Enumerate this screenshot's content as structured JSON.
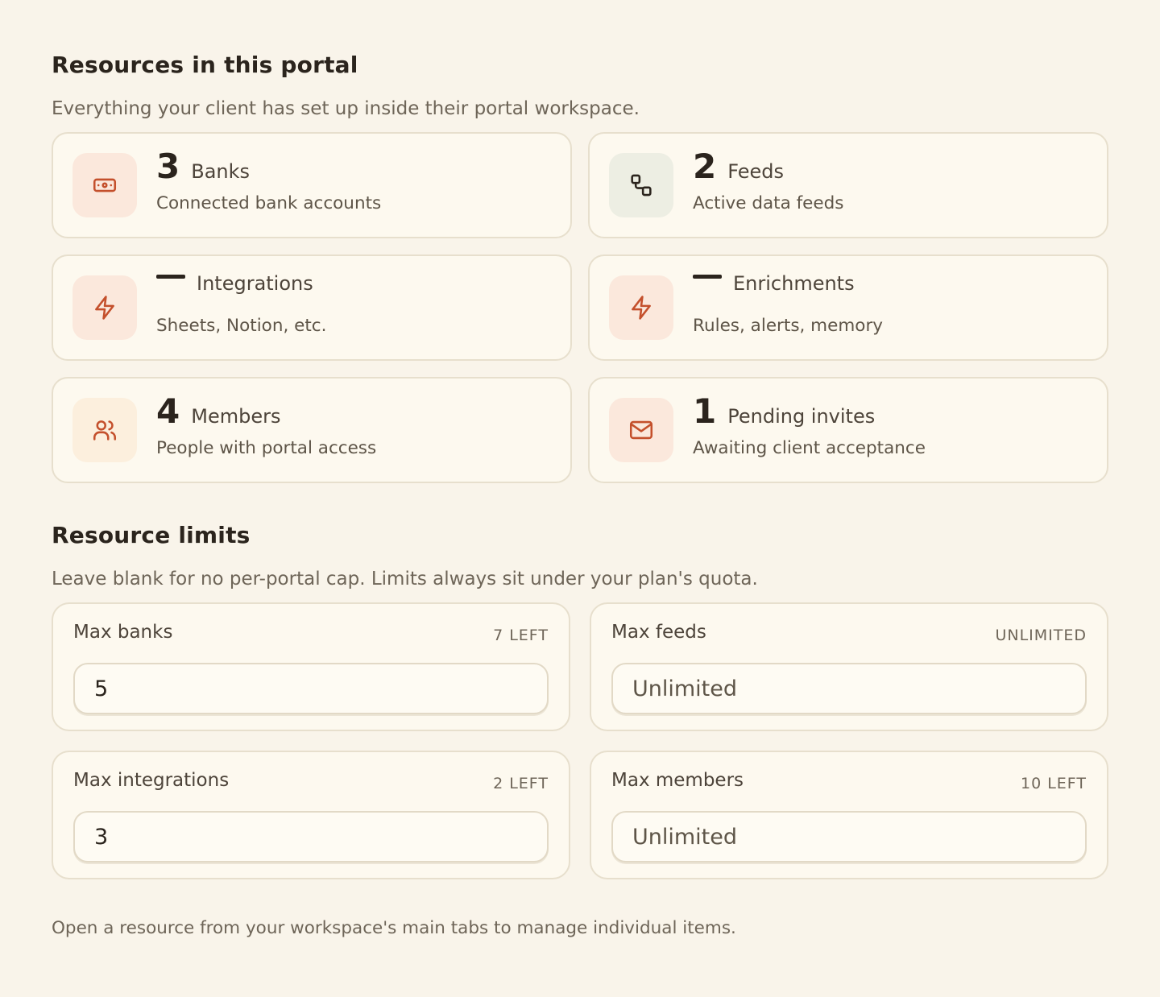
{
  "resources": {
    "title": "Resources in this portal",
    "subtitle": "Everything your client has set up inside their portal workspace.",
    "cards": [
      {
        "count": "3",
        "label": "Banks",
        "desc": "Connected bank accounts",
        "icon": "banknote-icon",
        "tone": "#fbe8dc",
        "icon_color": "#c4502c"
      },
      {
        "count": "2",
        "label": "Feeds",
        "desc": "Active data feeds",
        "icon": "workflow-icon",
        "tone": "#edeee3",
        "icon_color": "#2b241d"
      },
      {
        "count": null,
        "label": "Integrations",
        "desc": "Sheets, Notion, etc.",
        "icon": "zap-icon",
        "tone": "#fbe8dc",
        "icon_color": "#c4502c"
      },
      {
        "count": null,
        "label": "Enrichments",
        "desc": "Rules, alerts, memory",
        "icon": "zap-icon",
        "tone": "#fbe8dc",
        "icon_color": "#c4502c"
      },
      {
        "count": "4",
        "label": "Members",
        "desc": "People with portal access",
        "icon": "users-icon",
        "tone": "#fcefdd",
        "icon_color": "#c4502c"
      },
      {
        "count": "1",
        "label": "Pending invites",
        "desc": "Awaiting client acceptance",
        "icon": "mail-icon",
        "tone": "#fbe8dc",
        "icon_color": "#c4502c"
      }
    ]
  },
  "limits": {
    "title": "Resource limits",
    "subtitle": "Leave blank for no per-portal cap. Limits always sit under your plan's quota.",
    "fields": [
      {
        "label": "Max banks",
        "badge": "7 LEFT",
        "value": "5",
        "placeholder": "Unlimited"
      },
      {
        "label": "Max feeds",
        "badge": "UNLIMITED",
        "value": "",
        "placeholder": "Unlimited"
      },
      {
        "label": "Max integrations",
        "badge": "2 LEFT",
        "value": "3",
        "placeholder": "Unlimited"
      },
      {
        "label": "Max members",
        "badge": "10 LEFT",
        "value": "",
        "placeholder": "Unlimited"
      }
    ]
  },
  "footer_note": "Open a resource from your workspace's main tabs to manage individual items.",
  "colors": {
    "background": "#f9f4ea",
    "card": "#fdf9ef",
    "accent": "#c4502c"
  }
}
